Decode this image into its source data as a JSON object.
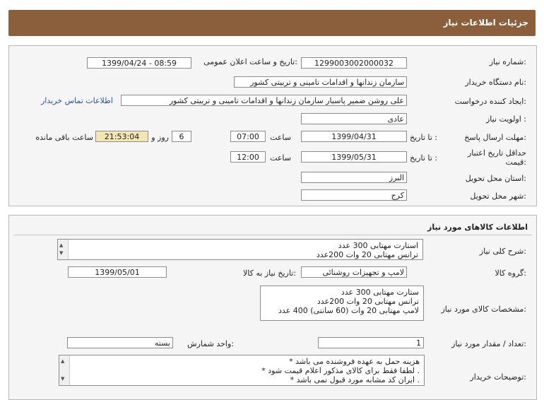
{
  "page_title": "جزئیات اطلاعات نیاز",
  "info": {
    "need_number_label": "شماره نیاز:",
    "need_number": "1299003002000032",
    "announce_label": "تاریخ و ساعت اعلان عمومی:",
    "announce_value": "1399/04/24 - 08:59",
    "buyer_org_label": "نام دستگاه خریدار:",
    "buyer_org": "سازمان زندانها و اقدامات تامینی و تربیتی کشور",
    "requester_label": "ایجاد کننده درخواست:",
    "requester": "علی روشن ضمیر پاسیار سازمان زندانها و اقدامات تامینی و تربیتی کشور",
    "contact_link": "اطلاعات تماس خریدار",
    "priority_label": "اولویت نیاز :",
    "priority": "عادی",
    "deadline_label": "مهلت ارسال پاسخ:",
    "to_date_label": "تا تاریخ :",
    "deadline_date": "1399/04/31",
    "hour_label": "ساعت",
    "deadline_time": "07:00",
    "days_value": "6",
    "days_label": "روز و",
    "remaining_time": "21:53:04",
    "remaining_label": "ساعت باقی مانده",
    "validity_label": "حداقل تاریخ اعتبار قیمت:",
    "validity_to_label": "تا تاریخ :",
    "validity_date": "1399/05/31",
    "validity_hour_label": "ساعت",
    "validity_time": "12:00",
    "province_label": "استان محل تحویل:",
    "province": "البرز",
    "city_label": "شهر محل تحویل:",
    "city": "کرج"
  },
  "goods": {
    "section_title": "اطلاعات کالاهای مورد نیاز",
    "summary_label": "شرح کلی نیاز:",
    "summary_lines": [
      "استارت مهتابی 300 عدد",
      "ترانس مهتابی 20 وات 200عدد"
    ],
    "group_label": "گروه کالا:",
    "group_value": "لامپ و تجهیزات روشنائی",
    "need_date_label": "تاریخ نیاز به کالا:",
    "need_date": "1399/05/01",
    "specs_label": "مشخصات کالای مورد نیاز:",
    "specs_lines": [
      "ستارت مهتابی 300 عدد",
      "ترانس مهتابی 20 وات 200عدد",
      "لامپ مهتابی 20 وات (60 سانتی) 400 عدد"
    ],
    "qty_label": "تعداد / مقدار مورد نیاز:",
    "qty": "1",
    "unit_label": "واحد شمارش:",
    "unit": "بسته",
    "notes_label": "توضیحات خریدار:",
    "notes_lines": [
      "هزینه حمل به عهده فروشنده می باشد *",
      ". لطفا فقط برای کالای مذکور اعلام قیمت شود *",
      ". ایران کد مشابه مورد قبول نمی باشد *"
    ]
  }
}
